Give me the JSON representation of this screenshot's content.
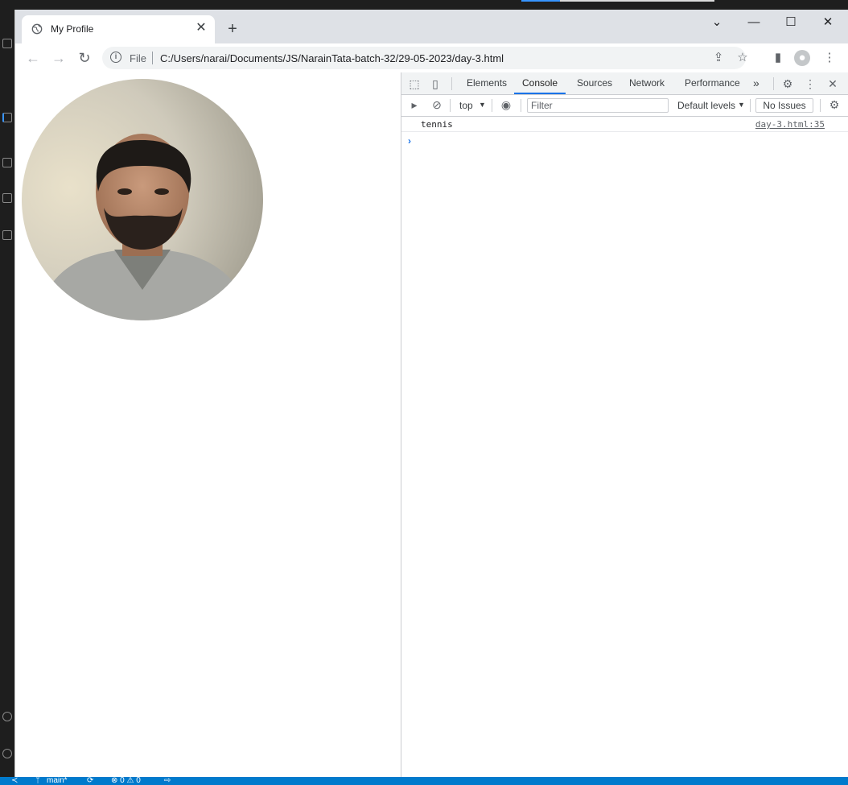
{
  "browser": {
    "tab_title": "My Profile",
    "new_tab": "+",
    "address": {
      "scheme_label": "File",
      "url": "C:/Users/narai/Documents/JS/NarainTata-batch-32/29-05-2023/day-3.html"
    }
  },
  "devtools": {
    "tabs": [
      "Elements",
      "Console",
      "Sources",
      "Network",
      "Performance"
    ],
    "more": "»",
    "context": "top",
    "filter_placeholder": "Filter",
    "levels": "Default levels",
    "issues": "No Issues",
    "console": {
      "message": "tennis",
      "source": "day-3.html:35"
    }
  },
  "status_bar": {
    "branch": "main*",
    "problems": "⊗ 0 ⚠ 0"
  },
  "colors": {
    "accent": "#1a73e8",
    "vscode_status": "#007acc"
  }
}
